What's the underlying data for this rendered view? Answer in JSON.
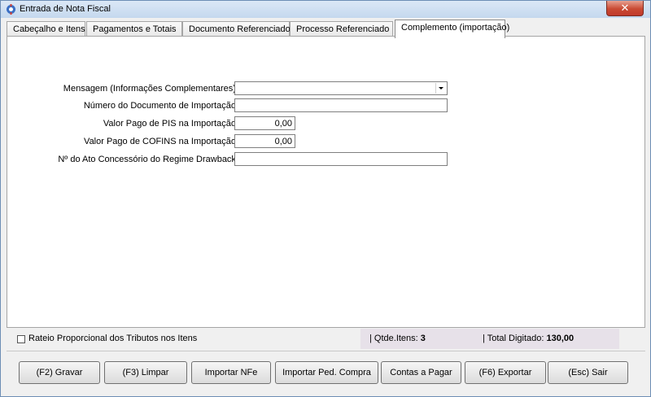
{
  "window": {
    "title": "Entrada de Nota Fiscal",
    "close_label": "✕"
  },
  "tabs": [
    {
      "label": "Cabeçalho e Itens",
      "active": false
    },
    {
      "label": "Pagamentos e Totais",
      "active": false
    },
    {
      "label": "Documento Referenciado",
      "active": false
    },
    {
      "label": "Processo Referenciado",
      "active": false
    },
    {
      "label": "Complemento (importação)",
      "active": true
    }
  ],
  "form": {
    "mensagem_label": "Mensagem (Informações Complementares):",
    "mensagem_value": "",
    "num_doc_label": "Número do Documento de Importação:",
    "num_doc_value": "",
    "pis_label": "Valor Pago de PIS na Importação:",
    "pis_value": "0,00",
    "cofins_label": "Valor Pago de COFINS na Importação:",
    "cofins_value": "0,00",
    "ato_label": "Nº do Ato Concessório do Regime Drawback:",
    "ato_value": ""
  },
  "footer": {
    "rateio_label": "Rateio Proporcional dos Tributos nos Itens",
    "qtde_label": "| Qtde.Itens:",
    "qtde_value": "3",
    "total_label": "| Total Digitado:",
    "total_value": "130,00"
  },
  "buttons": {
    "gravar": "(F2) Gravar",
    "limpar": "(F3) Limpar",
    "importar_nfe": "Importar NFe",
    "importar_ped": "Importar Ped. Compra",
    "contas": "Contas a Pagar",
    "exportar": "(F6) Exportar",
    "sair": "(Esc) Sair"
  },
  "colors": {
    "title_gradient_top": "#dbe8f6",
    "close_red": "#c94a33",
    "totals_bg": "#e7e1e9"
  }
}
